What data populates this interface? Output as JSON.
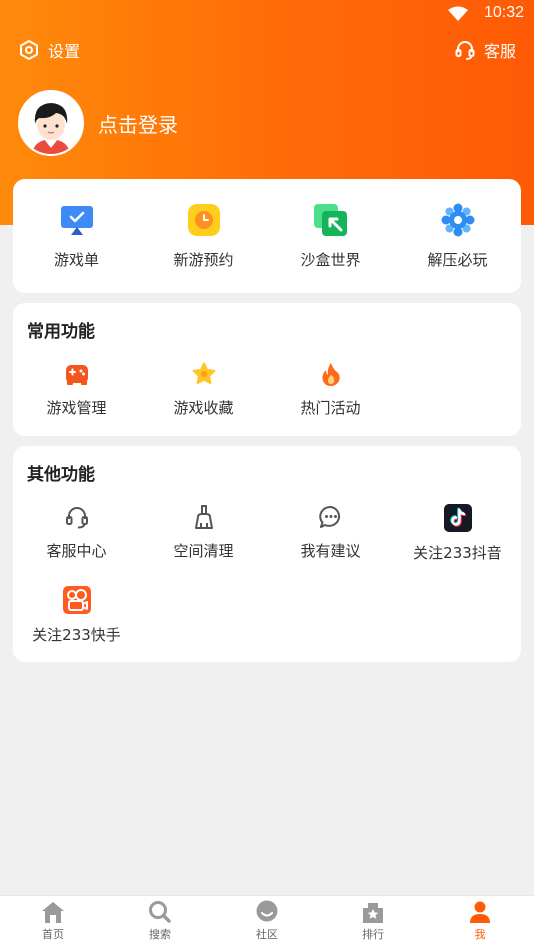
{
  "status_bar": {
    "time": "10:32"
  },
  "header": {
    "settings_label": "设置",
    "service_label": "客服",
    "login_label": "点击登录"
  },
  "top_card": {
    "items": [
      {
        "label": "游戏单",
        "icon": "monitor-check-icon"
      },
      {
        "label": "新游预约",
        "icon": "clock-icon"
      },
      {
        "label": "沙盒世界",
        "icon": "sandbox-arrow-icon"
      },
      {
        "label": "解压必玩",
        "icon": "gear-flower-icon"
      }
    ]
  },
  "common": {
    "title": "常用功能",
    "items": [
      {
        "label": "游戏管理",
        "icon": "gamepad-icon"
      },
      {
        "label": "游戏收藏",
        "icon": "star-icon"
      },
      {
        "label": "热门活动",
        "icon": "flame-icon"
      }
    ]
  },
  "other": {
    "title": "其他功能",
    "items": [
      {
        "label": "客服中心",
        "icon": "headset-icon"
      },
      {
        "label": "空间清理",
        "icon": "broom-icon"
      },
      {
        "label": "我有建议",
        "icon": "chat-bubble-icon"
      },
      {
        "label": "关注233抖音",
        "icon": "douyin-icon"
      },
      {
        "label": "关注233快手",
        "icon": "kuaishou-icon"
      }
    ]
  },
  "colors": {
    "accent": "#ff5a06",
    "header_start": "#ff8a0a",
    "header_end": "#ff5a06"
  },
  "nav": {
    "items": [
      {
        "label": "首页",
        "icon": "home-icon"
      },
      {
        "label": "搜索",
        "icon": "search-icon"
      },
      {
        "label": "社区",
        "icon": "community-icon"
      },
      {
        "label": "排行",
        "icon": "ranking-icon"
      },
      {
        "label": "我",
        "icon": "user-icon",
        "active": true
      }
    ]
  }
}
